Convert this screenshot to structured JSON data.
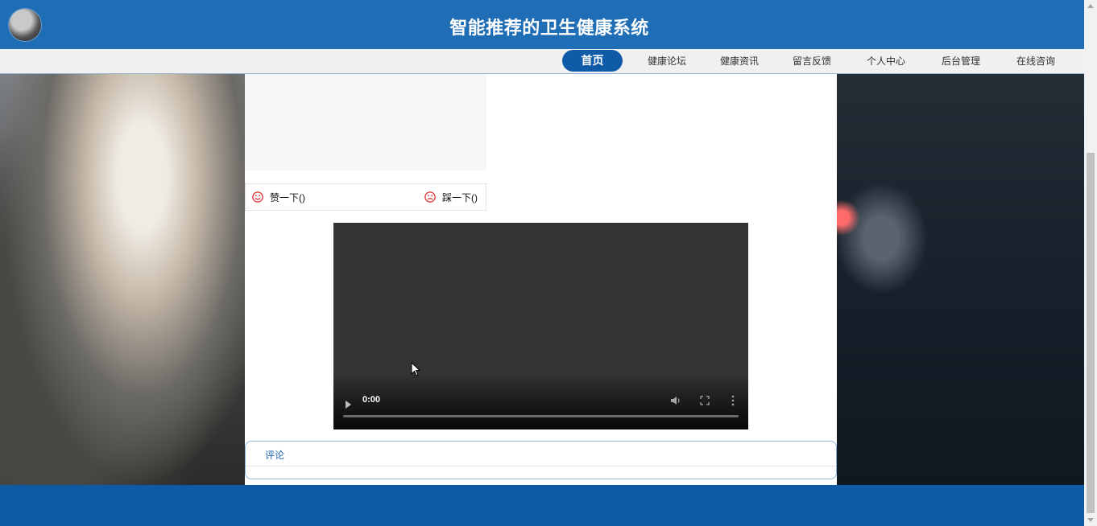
{
  "header": {
    "title": "智能推荐的卫生健康系统",
    "logo_icon": "logo-icon"
  },
  "nav": {
    "items": [
      {
        "label": "首页",
        "active": true
      },
      {
        "label": "健康论坛",
        "active": false
      },
      {
        "label": "健康资讯",
        "active": false
      },
      {
        "label": "留言反馈",
        "active": false
      },
      {
        "label": "个人中心",
        "active": false
      },
      {
        "label": "后台管理",
        "active": false
      },
      {
        "label": "在线咨询",
        "active": false
      }
    ]
  },
  "vote": {
    "like_label": "赞一下()",
    "dislike_label": "踩一下()",
    "like_icon": "smile-icon",
    "dislike_icon": "frown-icon"
  },
  "video": {
    "time": "0:00",
    "progress": 0
  },
  "comments": {
    "tab_label": "评论"
  },
  "colors": {
    "header_bg": "#1f6db5",
    "nav_active_bg": "#0f5ba7",
    "footer_bg": "#0d5ba6",
    "icon_red": "#e0262a"
  }
}
